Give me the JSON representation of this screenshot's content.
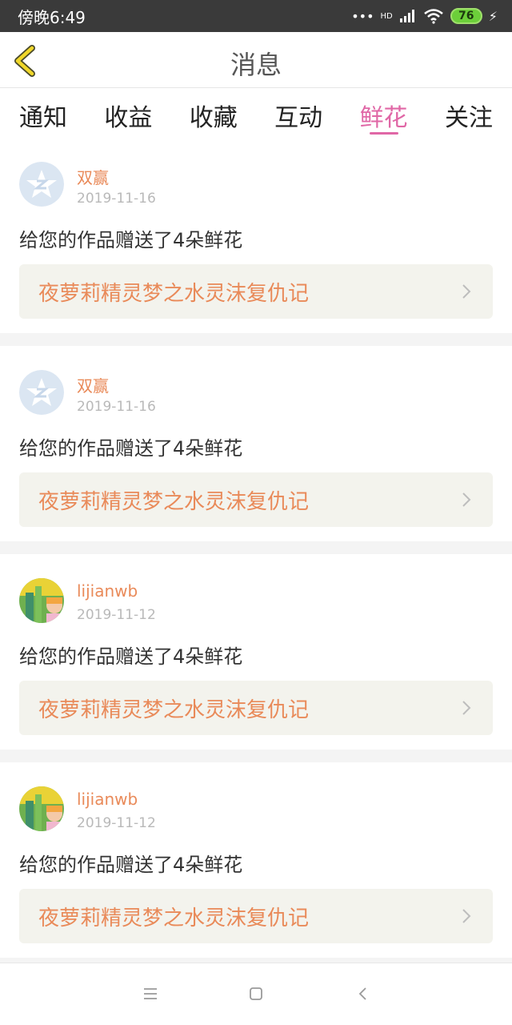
{
  "status_bar": {
    "time": "傍晚6:49",
    "network": "HD",
    "battery": "76"
  },
  "header": {
    "title": "消息"
  },
  "tabs": [
    {
      "label": "通知",
      "active": false
    },
    {
      "label": "收益",
      "active": false
    },
    {
      "label": "收藏",
      "active": false
    },
    {
      "label": "互动",
      "active": false
    },
    {
      "label": "鲜花",
      "active": true
    },
    {
      "label": "关注",
      "active": false
    }
  ],
  "items": [
    {
      "user": "双赢",
      "date": "2019-11-16",
      "message": "给您的作品赠送了4朵鲜花",
      "book": "夜萝莉精灵梦之水灵沫复仇记",
      "avatar": "default-avatar"
    },
    {
      "user": "双赢",
      "date": "2019-11-16",
      "message": "给您的作品赠送了4朵鲜花",
      "book": "夜萝莉精灵梦之水灵沫复仇记",
      "avatar": "default-avatar"
    },
    {
      "user": "lijianwb",
      "date": "2019-11-12",
      "message": "给您的作品赠送了4朵鲜花",
      "book": "夜萝莉精灵梦之水灵沫复仇记",
      "avatar": "photo-avatar"
    },
    {
      "user": "lijianwb",
      "date": "2019-11-12",
      "message": "给您的作品赠送了4朵鲜花",
      "book": "夜萝莉精灵梦之水灵沫复仇记",
      "avatar": "photo-avatar"
    }
  ],
  "colors": {
    "accent_pink": "#e067a6",
    "accent_orange": "#e98a59",
    "back_arrow_yellow": "#f0d72a"
  },
  "icons": {
    "back": "back-chevron-icon",
    "item_arrow": "chevron-right-icon",
    "nav_menu": "menu-icon",
    "nav_home": "home-square-icon",
    "nav_back": "back-triangle-icon"
  }
}
